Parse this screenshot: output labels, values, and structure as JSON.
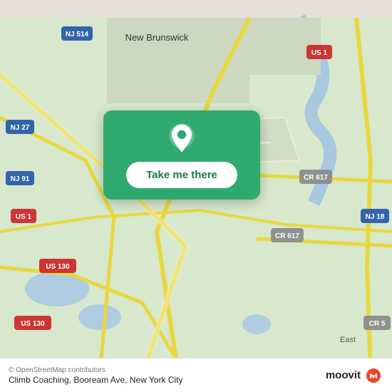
{
  "map": {
    "attribution": "© OpenStreetMap contributors",
    "location_label": "Climb Coaching, Booream Ave, New York City",
    "background_color": "#dde8d4",
    "road_color": "#f5f0c8",
    "water_color": "#b3d4e8"
  },
  "popup": {
    "button_label": "Take me there",
    "bg_color": "#2eaa6e"
  },
  "moovit": {
    "logo_text": "moovit",
    "icon_color_top": "#e8472a",
    "icon_color_bottom": "#c0392b"
  },
  "labels": {
    "new_brunswick": "New Brunswick",
    "nj_514": "NJ 514",
    "nj_27": "NJ 27",
    "nj_91": "NJ 91",
    "us_1_top": "US 1",
    "us_1_mid": "US 1",
    "us_130_top": "US 130",
    "us_130_bot": "US 130",
    "cr_617_right": "CR 617",
    "cr_617_mid": "CR 617",
    "nj_18": "NJ 18",
    "east": "East"
  }
}
